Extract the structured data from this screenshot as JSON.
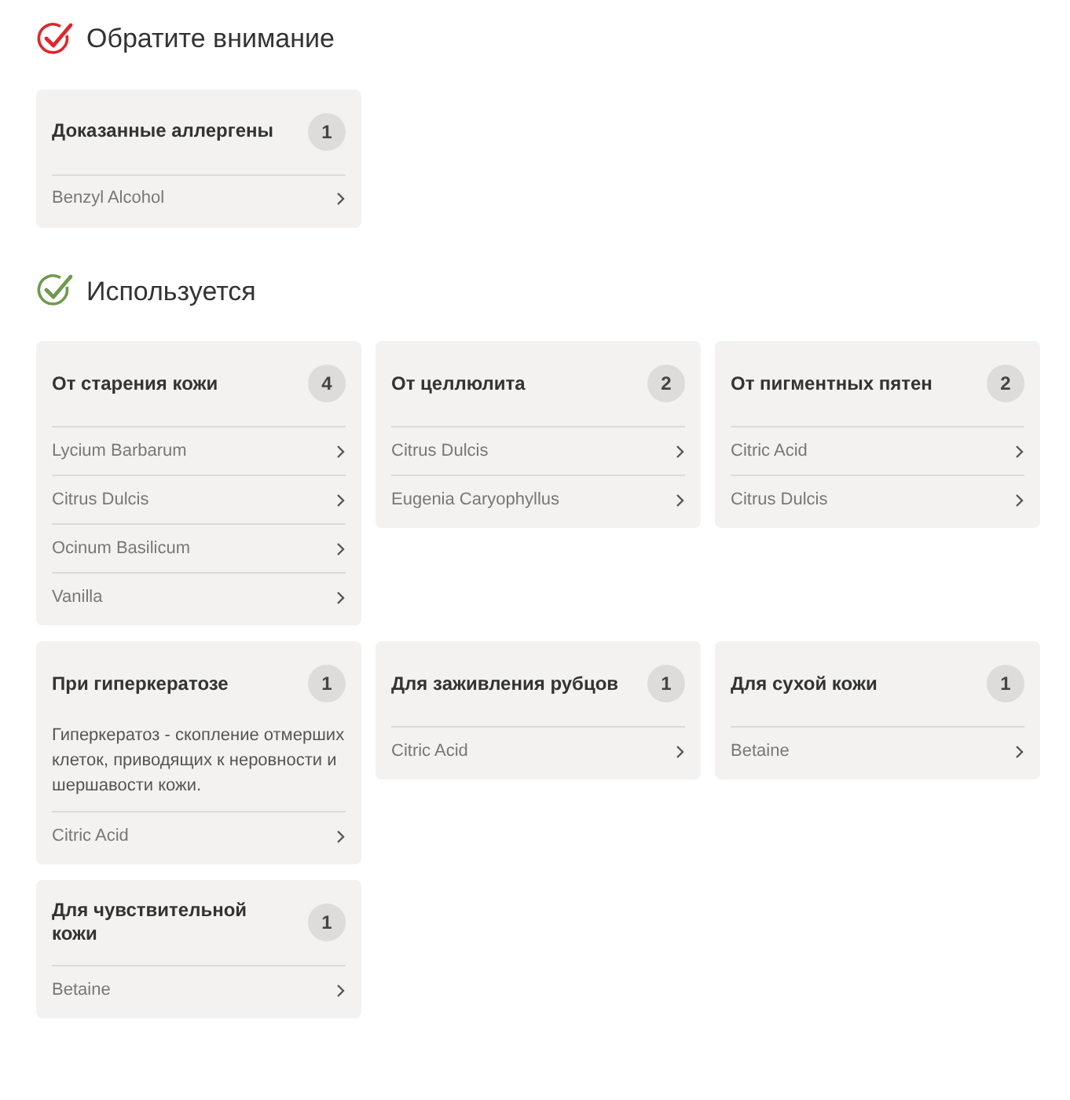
{
  "sections": [
    {
      "title": "Обратите внимание",
      "kind": "warning",
      "cards": [
        {
          "title": "Доказанные аллергены",
          "count": "1",
          "items": [
            "Benzyl Alcohol"
          ]
        }
      ]
    },
    {
      "title": "Используется",
      "kind": "used",
      "cards": [
        {
          "title": "От старения кожи",
          "count": "4",
          "items": [
            "Lycium Barbarum",
            "Citrus Dulcis",
            "Ocinum Basilicum",
            "Vanilla"
          ]
        },
        {
          "title": "От целлюлита",
          "count": "2",
          "items": [
            "Citrus Dulcis",
            "Eugenia Caryophyllus"
          ]
        },
        {
          "title": "От пигментных пятен",
          "count": "2",
          "items": [
            "Citric Acid",
            "Citrus Dulcis"
          ]
        },
        {
          "title": "При гиперкератозе",
          "count": "1",
          "description": "Гиперкератоз - скопление отмерших клеток, приводящих к неровности и шершавости кожи.",
          "items": [
            "Citric Acid"
          ]
        },
        {
          "title": "Для заживления рубцов",
          "count": "1",
          "items": [
            "Citric Acid"
          ]
        },
        {
          "title": "Для сухой кожи",
          "count": "1",
          "items": [
            "Betaine"
          ]
        },
        {
          "title": "Для чувствительной кожи",
          "count": "1",
          "items": [
            "Betaine"
          ]
        }
      ]
    }
  ]
}
